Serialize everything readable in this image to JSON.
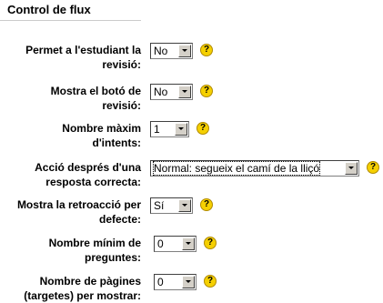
{
  "section": {
    "title": "Control de flux"
  },
  "fields": [
    {
      "label_line1": "Permet a l'estudiant la",
      "label_line2": "revisió:",
      "value": "No"
    },
    {
      "label_line1": "Mostra el botó de",
      "label_line2": "revisió:",
      "value": "No"
    },
    {
      "label_line1": "Nombre màxim",
      "label_line2": "d'intents:",
      "value": "1"
    },
    {
      "label_line1": "Acció després d'una",
      "label_line2": "resposta correcta:",
      "value": "Normal: segueix el camí de la lliçó"
    },
    {
      "label_line1": "Mostra la retroacció per",
      "label_line2": "defecte:",
      "value": "Sí"
    },
    {
      "label_line1": "Nombre mínim de",
      "label_line2": "preguntes:",
      "value": "0"
    },
    {
      "label_line1": "Nombre de pàgines",
      "label_line2": "(targetes) per mostrar:",
      "value": "0"
    }
  ],
  "help_icon": {
    "glyph": "?",
    "color": "#f5d000"
  }
}
